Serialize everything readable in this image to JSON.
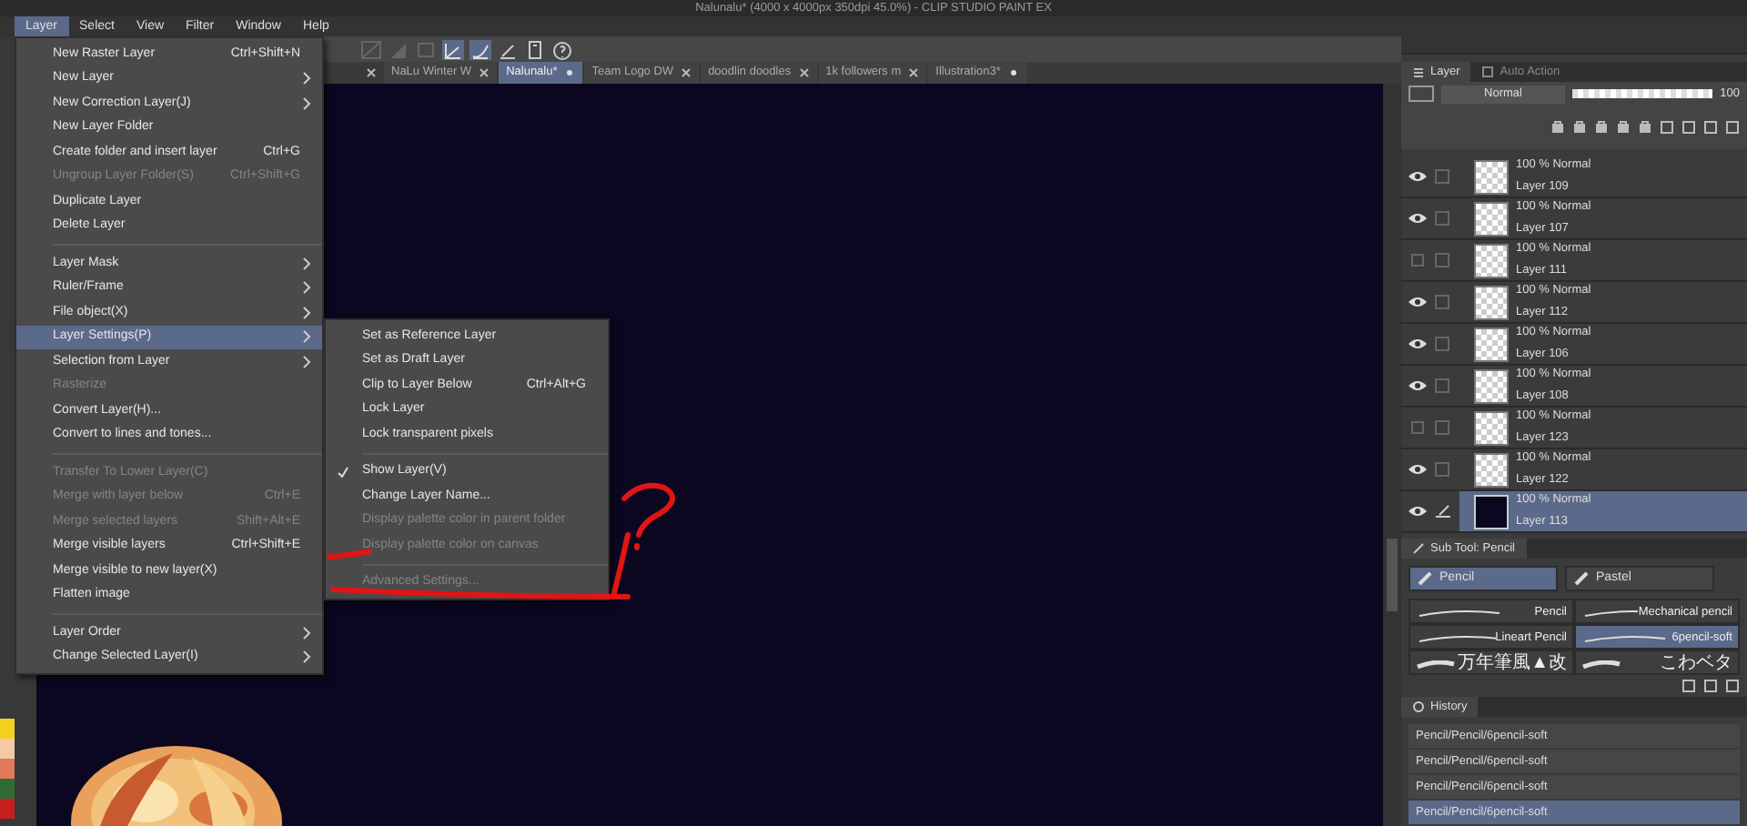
{
  "window": {
    "title": "Nalunalu* (4000 x 4000px 350dpi 45.0%)  - CLIP STUDIO PAINT EX"
  },
  "menu_bar": [
    {
      "label": "Layer",
      "selected": true
    },
    {
      "label": "Select",
      "selected": false
    },
    {
      "label": "View",
      "selected": false
    },
    {
      "label": "Filter",
      "selected": false
    },
    {
      "label": "Window",
      "selected": false
    },
    {
      "label": "Help",
      "selected": false
    }
  ],
  "document_tabs": [
    {
      "label": "NaLu Winter W",
      "selected": false,
      "modified": false
    },
    {
      "label": "Nalunalu*",
      "selected": true,
      "modified": true
    },
    {
      "label": "Team Logo DW",
      "selected": false,
      "modified": false
    },
    {
      "label": "doodlin doodles",
      "selected": false,
      "modified": false
    },
    {
      "label": "1k followers m",
      "selected": false,
      "modified": false
    },
    {
      "label": "Illustration3*",
      "selected": false,
      "modified": true
    }
  ],
  "layer_menu": [
    {
      "kind": "item",
      "label": "New Raster Layer",
      "shortcut": "Ctrl+Shift+N",
      "submenu": false,
      "disabled": false,
      "selected": false
    },
    {
      "kind": "item",
      "label": "New Layer",
      "submenu": true,
      "disabled": false,
      "selected": false
    },
    {
      "kind": "item",
      "label": "New Correction Layer(J)",
      "submenu": true,
      "disabled": false,
      "selected": false
    },
    {
      "kind": "item",
      "label": "New Layer Folder",
      "submenu": false,
      "disabled": false,
      "selected": false
    },
    {
      "kind": "item",
      "label": "Create folder and insert layer",
      "shortcut": "Ctrl+G",
      "submenu": false,
      "disabled": false,
      "selected": false
    },
    {
      "kind": "item",
      "label": "Ungroup Layer Folder(S)",
      "shortcut": "Ctrl+Shift+G",
      "submenu": false,
      "disabled": true,
      "selected": false
    },
    {
      "kind": "item",
      "label": "Duplicate Layer",
      "submenu": false,
      "disabled": false,
      "selected": false
    },
    {
      "kind": "item",
      "label": "Delete Layer",
      "submenu": false,
      "disabled": false,
      "selected": false
    },
    {
      "kind": "separator"
    },
    {
      "kind": "item",
      "label": "Layer Mask",
      "submenu": true,
      "disabled": false,
      "selected": false
    },
    {
      "kind": "item",
      "label": "Ruler/Frame",
      "submenu": true,
      "disabled": false,
      "selected": false
    },
    {
      "kind": "item",
      "label": "File object(X)",
      "submenu": true,
      "disabled": false,
      "selected": false
    },
    {
      "kind": "item",
      "label": "Layer Settings(P)",
      "submenu": true,
      "disabled": false,
      "selected": true
    },
    {
      "kind": "item",
      "label": "Selection from Layer",
      "submenu": true,
      "disabled": false,
      "selected": false
    },
    {
      "kind": "item",
      "label": "Rasterize",
      "submenu": false,
      "disabled": true,
      "selected": false
    },
    {
      "kind": "item",
      "label": "Convert Layer(H)...",
      "submenu": false,
      "disabled": false,
      "selected": false
    },
    {
      "kind": "item",
      "label": "Convert to lines and tones...",
      "submenu": false,
      "disabled": false,
      "selected": false
    },
    {
      "kind": "separator"
    },
    {
      "kind": "item",
      "label": "Transfer To Lower Layer(C)",
      "submenu": false,
      "disabled": true,
      "selected": false
    },
    {
      "kind": "item",
      "label": "Merge with layer below",
      "shortcut": "Ctrl+E",
      "submenu": false,
      "disabled": true,
      "selected": false
    },
    {
      "kind": "item",
      "label": "Merge selected layers",
      "shortcut": "Shift+Alt+E",
      "submenu": false,
      "disabled": true,
      "selected": false
    },
    {
      "kind": "item",
      "label": "Merge visible layers",
      "shortcut": "Ctrl+Shift+E",
      "submenu": false,
      "disabled": false,
      "selected": false
    },
    {
      "kind": "item",
      "label": "Merge visible to new layer(X)",
      "submenu": false,
      "disabled": false,
      "selected": false
    },
    {
      "kind": "item",
      "label": "Flatten image",
      "submenu": false,
      "disabled": false,
      "selected": false
    },
    {
      "kind": "separator"
    },
    {
      "kind": "item",
      "label": "Layer Order",
      "submenu": true,
      "disabled": false,
      "selected": false
    },
    {
      "kind": "item",
      "label": "Change Selected Layer(I)",
      "submenu": true,
      "disabled": false,
      "selected": false
    }
  ],
  "layer_settings_submenu": [
    {
      "kind": "item",
      "label": "Set as Reference Layer",
      "checked": false,
      "disabled": false
    },
    {
      "kind": "item",
      "label": "Set as Draft Layer",
      "checked": false,
      "disabled": false
    },
    {
      "kind": "item",
      "label": "Clip to Layer Below",
      "shortcut": "Ctrl+Alt+G",
      "checked": false,
      "disabled": false
    },
    {
      "kind": "item",
      "label": "Lock Layer",
      "checked": false,
      "disabled": false
    },
    {
      "kind": "item",
      "label": "Lock transparent pixels",
      "checked": false,
      "disabled": false
    },
    {
      "kind": "separator"
    },
    {
      "kind": "item",
      "label": "Show Layer(V)",
      "checked": true,
      "disabled": false
    },
    {
      "kind": "item",
      "label": "Change Layer Name...",
      "checked": false,
      "disabled": false
    },
    {
      "kind": "item",
      "label": "Display palette color in parent folder",
      "checked": false,
      "disabled": true
    },
    {
      "kind": "item",
      "label": "Display palette color on canvas",
      "checked": false,
      "disabled": true
    },
    {
      "kind": "separator"
    },
    {
      "kind": "item",
      "label": "Advanced Settings...",
      "checked": false,
      "disabled": true
    }
  ],
  "palette": [
    {
      "color": "#f2d21c"
    },
    {
      "color": "#f3c9a8"
    },
    {
      "color": "#e07a5a"
    },
    {
      "color": "#2f6b35"
    },
    {
      "color": "#c81e1e"
    }
  ],
  "layer_panel": {
    "tabs": [
      {
        "label": "Layer",
        "selected": true
      },
      {
        "label": "Auto Action",
        "selected": false
      }
    ],
    "blend_mode": "Normal",
    "opacity": "100",
    "opacity_slider": {
      "level": 1
    },
    "layers": [
      {
        "name": "Layer 109",
        "mode": "100 % Normal",
        "visible": true,
        "checked": false,
        "selected": false,
        "kind": "transparent"
      },
      {
        "name": "Layer 107",
        "mode": "100 % Normal",
        "visible": true,
        "checked": false,
        "selected": false,
        "kind": "transparent"
      },
      {
        "name": "Layer 111",
        "mode": "100 % Normal",
        "visible": false,
        "checked": false,
        "selected": false,
        "kind": "transparent"
      },
      {
        "name": "Layer 112",
        "mode": "100 % Normal",
        "visible": true,
        "checked": false,
        "selected": false,
        "kind": "transparent"
      },
      {
        "name": "Layer 106",
        "mode": "100 % Normal",
        "visible": true,
        "checked": false,
        "selected": false,
        "kind": "transparent"
      },
      {
        "name": "Layer 108",
        "mode": "100 % Normal",
        "visible": true,
        "checked": false,
        "selected": false,
        "kind": "transparent"
      },
      {
        "name": "Layer 123",
        "mode": "100 % Normal",
        "visible": false,
        "checked": false,
        "selected": false,
        "kind": "transparent"
      },
      {
        "name": "Layer 122",
        "mode": "100 % Normal",
        "visible": true,
        "checked": false,
        "selected": false,
        "kind": "transparent"
      },
      {
        "name": "Layer 113",
        "mode": "100 % Normal",
        "visible": true,
        "checked": false,
        "selected": true,
        "kind": "filled"
      }
    ]
  },
  "sub_tool": {
    "title": "Sub Tool: Pencil",
    "groups": [
      {
        "label": "Pencil",
        "selected": true
      },
      {
        "label": "Pastel",
        "selected": false
      }
    ],
    "brushes": [
      {
        "label": "Pencil",
        "selected": false
      },
      {
        "label": "Mechanical pencil",
        "selected": false
      },
      {
        "label": "Lineart Pencil",
        "selected": false
      },
      {
        "label": "6pencil-soft",
        "selected": true
      },
      {
        "label": "万年筆風▲改",
        "selected": false
      },
      {
        "label": "こわベタ",
        "selected": false
      }
    ]
  },
  "history": {
    "title": "History",
    "entries": [
      {
        "label": "Pencil/Pencil/6pencil-soft",
        "selected": false
      },
      {
        "label": "Pencil/Pencil/6pencil-soft",
        "selected": false
      },
      {
        "label": "Pencil/Pencil/6pencil-soft",
        "selected": false
      },
      {
        "label": "Pencil/Pencil/6pencil-soft",
        "selected": true
      }
    ]
  }
}
